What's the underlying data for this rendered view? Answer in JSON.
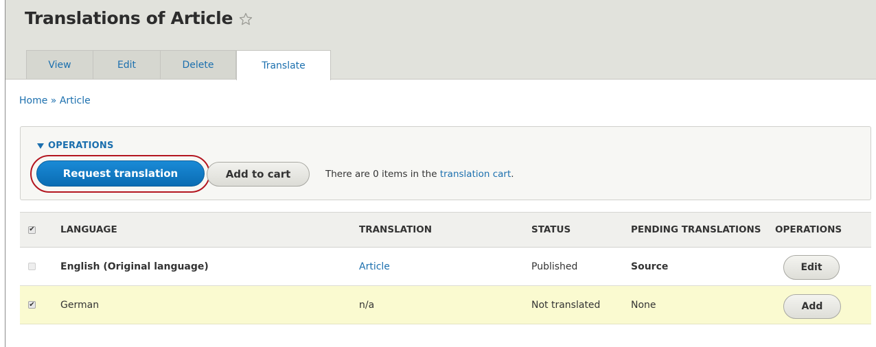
{
  "header": {
    "title": "Translations of Article",
    "star_icon": "star-outline-icon"
  },
  "tabs": [
    {
      "label": "View"
    },
    {
      "label": "Edit"
    },
    {
      "label": "Delete"
    },
    {
      "label": "Translate",
      "active": true
    }
  ],
  "breadcrumb": {
    "home": "Home",
    "separator": "»",
    "current": "Article"
  },
  "operations": {
    "summary_label": "OPERATIONS",
    "request_translation_label": "Request translation",
    "add_to_cart_label": "Add to cart",
    "cart_message_prefix": "There are 0 items in the",
    "cart_link_text": "translation cart",
    "cart_message_suffix": "."
  },
  "table": {
    "headers": {
      "language": "LANGUAGE",
      "translation": "TRANSLATION",
      "status": "STATUS",
      "pending": "PENDING TRANSLATIONS",
      "operations": "OPERATIONS"
    },
    "header_checked": true,
    "rows": [
      {
        "checked": false,
        "language": "English (Original language)",
        "translation": "Article",
        "status": "Published",
        "pending": "Source",
        "operation": "Edit"
      },
      {
        "checked": true,
        "language": "German",
        "translation": "n/a",
        "status": "Not translated",
        "pending": "None",
        "operation": "Add"
      }
    ]
  },
  "colors": {
    "link": "#1b6fae",
    "primary_button": "#0a6cb3",
    "highlight_ring": "#b3151f",
    "header_band": "#e1e2dc",
    "selected_row": "#fafad0"
  }
}
